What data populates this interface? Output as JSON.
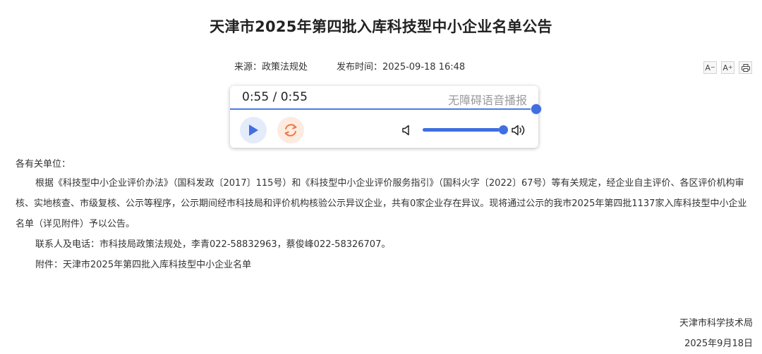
{
  "article": {
    "title": "天津市2025年第四批入库科技型中小企业名单公告",
    "source": "来源：政策法规处",
    "publish_time": "发布时间：2025-09-18 16:48"
  },
  "tools": {
    "font_decrease": "A",
    "font_increase": "A",
    "decrease_sign": "−",
    "increase_sign": "+",
    "print_icon": "printer-icon"
  },
  "player": {
    "time_display": "0:55 / 0:55",
    "a11y_label": "无障碍语音播报",
    "progress": 1.0,
    "volume": 0.95,
    "accent_color": "#3f6fe0"
  },
  "content": {
    "salutation": "各有关单位：",
    "paragraph_1": "根据《科技型中小企业评价办法》（国科发政〔2017〕115号）和《科技型中小企业评价服务指引》（国科火字〔2022〕67号）等有关规定，经企业自主评价、各区评价机构审核、实地核查、市级复核、公示等程序，公示期间经市科技局和评价机构核验公示异议企业，共有0家企业存在异议。现将通过公示的我市2025年第四批1137家入库科技型中小企业名单（详见附件）予以公告。",
    "contact": "联系人及电话：市科技局政策法规处，李青022-58832963，蔡俊峰022-58326707。",
    "attachment": "附件：天津市2025年第四批入库科技型中小企业名单"
  },
  "signoff": {
    "org": "天津市科学技术局",
    "date": "2025年9月18日"
  }
}
